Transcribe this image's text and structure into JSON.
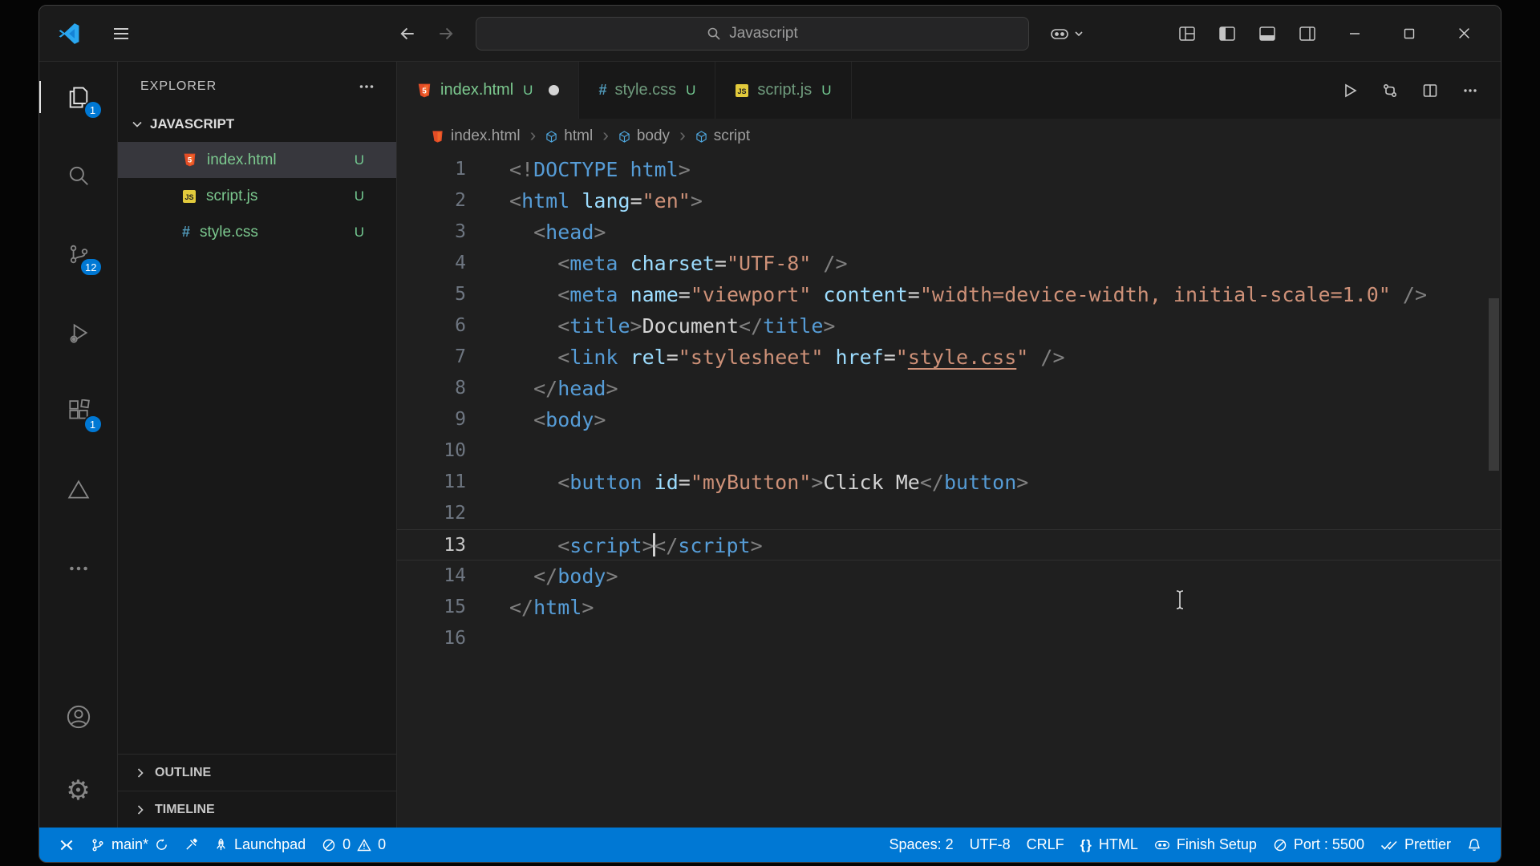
{
  "titlebar": {
    "search_text": "Javascript"
  },
  "activity_bar": {
    "explorer_badge": "1",
    "source_control_badge": "12",
    "extensions_badge": "1"
  },
  "sidebar": {
    "title": "EXPLORER",
    "workspace": "JAVASCRIPT",
    "files": [
      {
        "name": "index.html",
        "badge": "U"
      },
      {
        "name": "script.js",
        "badge": "U"
      },
      {
        "name": "style.css",
        "badge": "U"
      }
    ],
    "outline_label": "OUTLINE",
    "timeline_label": "TIMELINE"
  },
  "tabs": [
    {
      "name": "index.html",
      "badge": "U"
    },
    {
      "name": "style.css",
      "badge": "U"
    },
    {
      "name": "script.js",
      "badge": "U"
    }
  ],
  "breadcrumbs": [
    "index.html",
    "html",
    "body",
    "script"
  ],
  "editor": {
    "active_line": 13,
    "lines": [
      {
        "n": "1",
        "tokens": [
          [
            "<!",
            "p"
          ],
          [
            "DOCTYPE html",
            "t"
          ],
          [
            ">",
            "p"
          ]
        ]
      },
      {
        "n": "2",
        "tokens": [
          [
            "<",
            "p"
          ],
          [
            "html",
            "t"
          ],
          [
            " ",
            "x"
          ],
          [
            "lang",
            "a"
          ],
          [
            "=",
            "o"
          ],
          [
            "\"en\"",
            "s"
          ],
          [
            ">",
            "p"
          ]
        ]
      },
      {
        "n": "3",
        "tokens": [
          [
            "  ",
            "x"
          ],
          [
            "<",
            "p"
          ],
          [
            "head",
            "t"
          ],
          [
            ">",
            "p"
          ]
        ]
      },
      {
        "n": "4",
        "tokens": [
          [
            "    ",
            "x"
          ],
          [
            "<",
            "p"
          ],
          [
            "meta",
            "t"
          ],
          [
            " ",
            "x"
          ],
          [
            "charset",
            "a"
          ],
          [
            "=",
            "o"
          ],
          [
            "\"UTF-8\"",
            "s"
          ],
          [
            " ",
            "x"
          ],
          [
            "/>",
            "p"
          ]
        ]
      },
      {
        "n": "5",
        "tokens": [
          [
            "    ",
            "x"
          ],
          [
            "<",
            "p"
          ],
          [
            "meta",
            "t"
          ],
          [
            " ",
            "x"
          ],
          [
            "name",
            "a"
          ],
          [
            "=",
            "o"
          ],
          [
            "\"viewport\"",
            "s"
          ],
          [
            " ",
            "x"
          ],
          [
            "content",
            "a"
          ],
          [
            "=",
            "o"
          ],
          [
            "\"width=device-width, initial-scale=1.0\"",
            "s"
          ],
          [
            " ",
            "x"
          ],
          [
            "/>",
            "p"
          ]
        ]
      },
      {
        "n": "6",
        "tokens": [
          [
            "    ",
            "x"
          ],
          [
            "<",
            "p"
          ],
          [
            "title",
            "t"
          ],
          [
            ">",
            "p"
          ],
          [
            "Document",
            "x"
          ],
          [
            "</",
            "p"
          ],
          [
            "title",
            "t"
          ],
          [
            ">",
            "p"
          ]
        ]
      },
      {
        "n": "7",
        "tokens": [
          [
            "    ",
            "x"
          ],
          [
            "<",
            "p"
          ],
          [
            "link",
            "t"
          ],
          [
            " ",
            "x"
          ],
          [
            "rel",
            "a"
          ],
          [
            "=",
            "o"
          ],
          [
            "\"stylesheet\"",
            "s"
          ],
          [
            " ",
            "x"
          ],
          [
            "href",
            "a"
          ],
          [
            "=",
            "o"
          ],
          [
            "\"",
            "s"
          ],
          [
            "style.css",
            "u"
          ],
          [
            "\"",
            "s"
          ],
          [
            " ",
            "x"
          ],
          [
            "/>",
            "p"
          ]
        ]
      },
      {
        "n": "8",
        "tokens": [
          [
            "  ",
            "x"
          ],
          [
            "</",
            "p"
          ],
          [
            "head",
            "t"
          ],
          [
            ">",
            "p"
          ]
        ]
      },
      {
        "n": "9",
        "tokens": [
          [
            "  ",
            "x"
          ],
          [
            "<",
            "p"
          ],
          [
            "body",
            "t"
          ],
          [
            ">",
            "p"
          ]
        ]
      },
      {
        "n": "10",
        "tokens": []
      },
      {
        "n": "11",
        "tokens": [
          [
            "    ",
            "x"
          ],
          [
            "<",
            "p"
          ],
          [
            "button",
            "t"
          ],
          [
            " ",
            "x"
          ],
          [
            "id",
            "a"
          ],
          [
            "=",
            "o"
          ],
          [
            "\"myButton\"",
            "s"
          ],
          [
            ">",
            "p"
          ],
          [
            "Click Me",
            "x"
          ],
          [
            "</",
            "p"
          ],
          [
            "button",
            "t"
          ],
          [
            ">",
            "p"
          ]
        ]
      },
      {
        "n": "12",
        "tokens": []
      },
      {
        "n": "13",
        "tokens": [
          [
            "    ",
            "x"
          ],
          [
            "<",
            "p"
          ],
          [
            "script",
            "t"
          ],
          [
            ">",
            "p"
          ],
          [
            "",
            "c"
          ],
          [
            "</",
            "p"
          ],
          [
            "script",
            "t"
          ],
          [
            ">",
            "p"
          ]
        ]
      },
      {
        "n": "14",
        "tokens": [
          [
            "  ",
            "x"
          ],
          [
            "</",
            "p"
          ],
          [
            "body",
            "t"
          ],
          [
            ">",
            "p"
          ]
        ]
      },
      {
        "n": "15",
        "tokens": [
          [
            "</",
            "p"
          ],
          [
            "html",
            "t"
          ],
          [
            ">",
            "p"
          ]
        ]
      },
      {
        "n": "16",
        "tokens": []
      }
    ]
  },
  "status_bar": {
    "branch": "main*",
    "launchpad": "Launchpad",
    "errors": "0",
    "warnings": "0",
    "spaces": "Spaces: 2",
    "encoding": "UTF-8",
    "eol": "CRLF",
    "language_icon": "{}",
    "language": "HTML",
    "copilot": "Finish Setup",
    "port": "Port : 5500",
    "formatter": "Prettier"
  },
  "colors": {
    "status_bar": "#0078d4",
    "badge": "#0078d4",
    "untracked_green": "#73c991",
    "tag_blue": "#569cd6",
    "attr_blue": "#9cdcfe",
    "string_orange": "#ce9178"
  }
}
